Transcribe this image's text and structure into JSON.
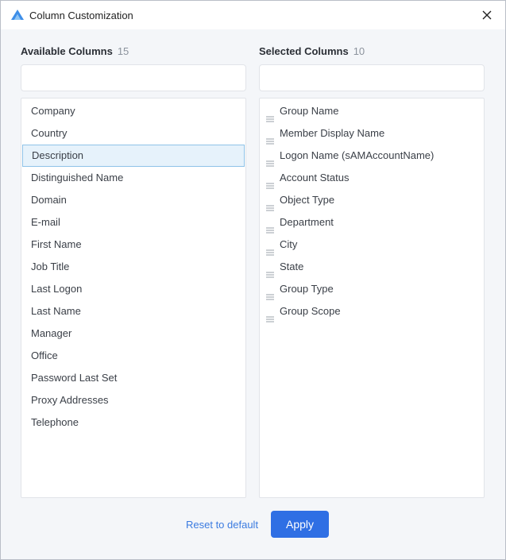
{
  "dialog": {
    "title": "Column Customization",
    "close_icon": "close-icon",
    "logo_icon": "app-logo-icon"
  },
  "available": {
    "heading": "Available Columns",
    "count": "15",
    "search_value": "",
    "items": [
      "Company",
      "Country",
      "Description",
      "Distinguished Name",
      "Domain",
      "E-mail",
      "First Name",
      "Job Title",
      "Last Logon",
      "Last Name",
      "Manager",
      "Office",
      "Password Last Set",
      "Proxy Addresses",
      "Telephone"
    ],
    "selected_item": "Description"
  },
  "selected": {
    "heading": "Selected Columns",
    "count": "10",
    "search_value": "",
    "items": [
      "Group Name",
      "Member Display Name",
      "Logon Name (sAMAccountName)",
      "Account Status",
      "Object Type",
      "Department",
      "City",
      "State",
      "Group Type",
      "Group Scope"
    ]
  },
  "footer": {
    "reset_label": "Reset to default",
    "apply_label": "Apply"
  },
  "colors": {
    "accent": "#2f6fe4",
    "link": "#3b7be0",
    "highlight_bg": "#e6f2fb",
    "highlight_border": "#8fc3e8"
  }
}
